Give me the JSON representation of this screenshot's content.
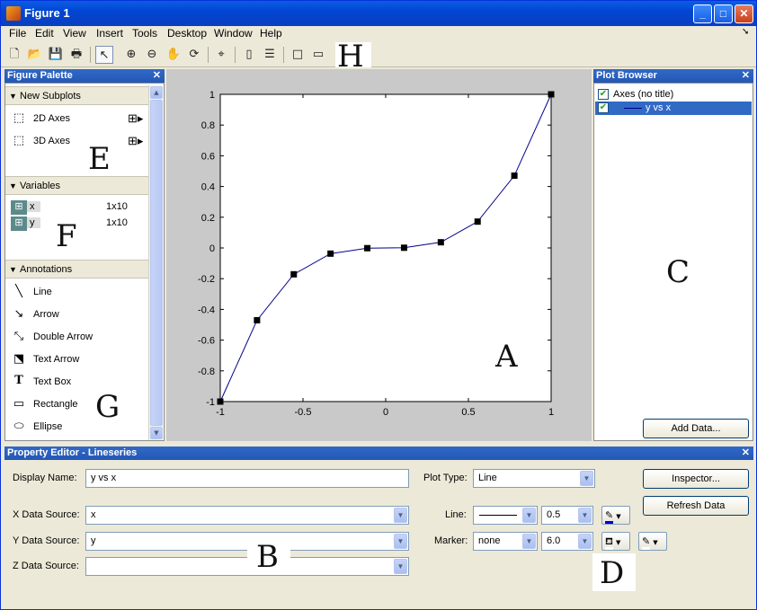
{
  "window": {
    "title": "Figure 1"
  },
  "menu": [
    "File",
    "Edit",
    "View",
    "Insert",
    "Tools",
    "Desktop",
    "Window",
    "Help"
  ],
  "toolbar_icons": [
    "new-icon",
    "open-icon",
    "save-icon",
    "print-icon",
    "arrow-pointer-icon",
    "zoom-in-icon",
    "zoom-out-icon",
    "pan-hand-icon",
    "rotate-3d-icon",
    "data-cursor-icon",
    "colorbar-icon",
    "legend-icon",
    "hide-tools-icon",
    "show-tools-icon"
  ],
  "figure_palette": {
    "title": "Figure Palette",
    "new_subplots": {
      "label": "New Subplots",
      "items": [
        "2D Axes",
        "3D Axes"
      ]
    },
    "variables": {
      "label": "Variables",
      "items": [
        {
          "name": "x",
          "size": "1x10"
        },
        {
          "name": "y",
          "size": "1x10"
        }
      ]
    },
    "annotations": {
      "label": "Annotations",
      "items": [
        "Line",
        "Arrow",
        "Double Arrow",
        "Text Arrow",
        "Text Box",
        "Rectangle",
        "Ellipse"
      ]
    }
  },
  "plot_browser": {
    "title": "Plot Browser",
    "items": [
      {
        "label": "Axes (no title)"
      },
      {
        "label": "y vs x"
      }
    ],
    "add_data_button": "Add Data..."
  },
  "property_editor": {
    "title": "Property Editor - Lineseries",
    "display_name_label": "Display Name:",
    "display_name": "y vs x",
    "x_source_label": "X Data Source:",
    "x_source": "x",
    "y_source_label": "Y Data Source:",
    "y_source": "y",
    "z_source_label": "Z Data Source:",
    "z_source": "",
    "plot_type_label": "Plot Type:",
    "plot_type": "Line",
    "line_label": "Line:",
    "line_width": "0.5",
    "marker_label": "Marker:",
    "marker": "none",
    "marker_size": "6.0",
    "inspector_button": "Inspector...",
    "refresh_button": "Refresh Data"
  },
  "annotation_letters": {
    "A": "A",
    "B": "B",
    "C": "C",
    "D": "D",
    "E": "E",
    "F": "F",
    "G": "G",
    "H": "H"
  },
  "colors": {
    "line": "#00008b",
    "title_bar": "#0a5ee6",
    "panel_header": "#3169c6",
    "selected_row": "#316ac5"
  },
  "chart_data": {
    "type": "line",
    "x": [
      -1,
      -0.7778,
      -0.5556,
      -0.3333,
      -0.1111,
      0.1111,
      0.3333,
      0.5556,
      0.7778,
      1
    ],
    "y": [
      -1,
      -0.4705,
      -0.1715,
      -0.037,
      -0.0014,
      0.0014,
      0.037,
      0.1715,
      0.4705,
      1
    ],
    "xlim": [
      -1,
      1
    ],
    "ylim": [
      -1,
      1
    ],
    "xticks": [
      "-1",
      "-0.5",
      "0",
      "0.5",
      "1"
    ],
    "yticks": [
      "-1",
      "-0.8",
      "-0.6",
      "-0.4",
      "-0.2",
      "0",
      "0.2",
      "0.4",
      "0.6",
      "0.8",
      "1"
    ],
    "grid": false,
    "markers_shown": true
  }
}
